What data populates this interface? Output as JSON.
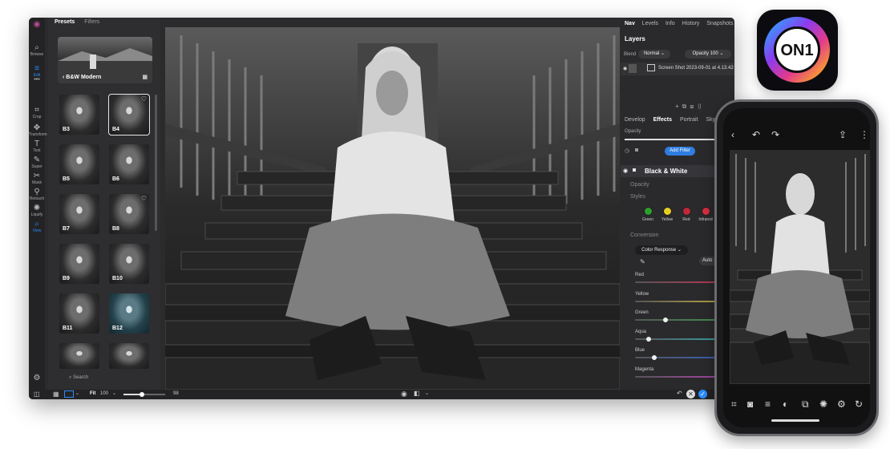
{
  "left_panel": {
    "tabs": [
      "Presets",
      "Filters"
    ],
    "banner": "B&W Modern",
    "presets": [
      "B3",
      "B4",
      "B5",
      "B6",
      "B7",
      "B8",
      "B9",
      "B10",
      "B11",
      "B12"
    ],
    "search_label": "Search"
  },
  "tools": [
    "Browse",
    "Edit",
    "Crop",
    "Transform",
    "Text",
    "Super",
    "Mask",
    "Retouch",
    "Liquify",
    "View"
  ],
  "bottom_bar": {
    "zoom_mode": "Fit",
    "zoom_value": "100",
    "slider_value": "98",
    "slider_level": 0.45
  },
  "right_panel": {
    "tabs": [
      "Nav",
      "Levels",
      "Info",
      "History",
      "Snapshots"
    ],
    "layers_title": "Layers",
    "blend_label": "Blend",
    "blend_value": "Normal",
    "opacity_label": "Opacity",
    "opacity_value": "100",
    "layer_name": "Screen Shot 2023-09-01 at 4.13.42",
    "edit_tabs": [
      "Develop",
      "Effects",
      "Portrait",
      "Sky"
    ],
    "opacity_small": "Opacity",
    "add_filter": "Add Filter",
    "filter_name": "Black & White",
    "filter_opacity": "Opacity",
    "styles_label": "Styles",
    "styles": [
      {
        "name": "Green",
        "color": "#2ca02c"
      },
      {
        "name": "Yellow",
        "color": "#e8d020"
      },
      {
        "name": "Red",
        "color": "#c0283a"
      },
      {
        "name": "Infrared",
        "color": "#d63040"
      }
    ],
    "conversion_label": "Conversion",
    "color_response": "Color Response",
    "auto_label": "Auto",
    "sliders": [
      {
        "label": "Red",
        "level": 0.96,
        "color": "#c83050"
      },
      {
        "label": "Yellow",
        "level": 0.94,
        "color": "#c8b040"
      },
      {
        "label": "Green",
        "level": 0.3,
        "color": "#3a9a50"
      },
      {
        "label": "Aqua",
        "level": 0.12,
        "color": "#30a8b0"
      },
      {
        "label": "Blue",
        "level": 0.18,
        "color": "#3060c8"
      },
      {
        "label": "Magenta",
        "level": 0.92,
        "color": "#b040b0"
      }
    ]
  },
  "app_icon": {
    "lettering": "ON1"
  }
}
